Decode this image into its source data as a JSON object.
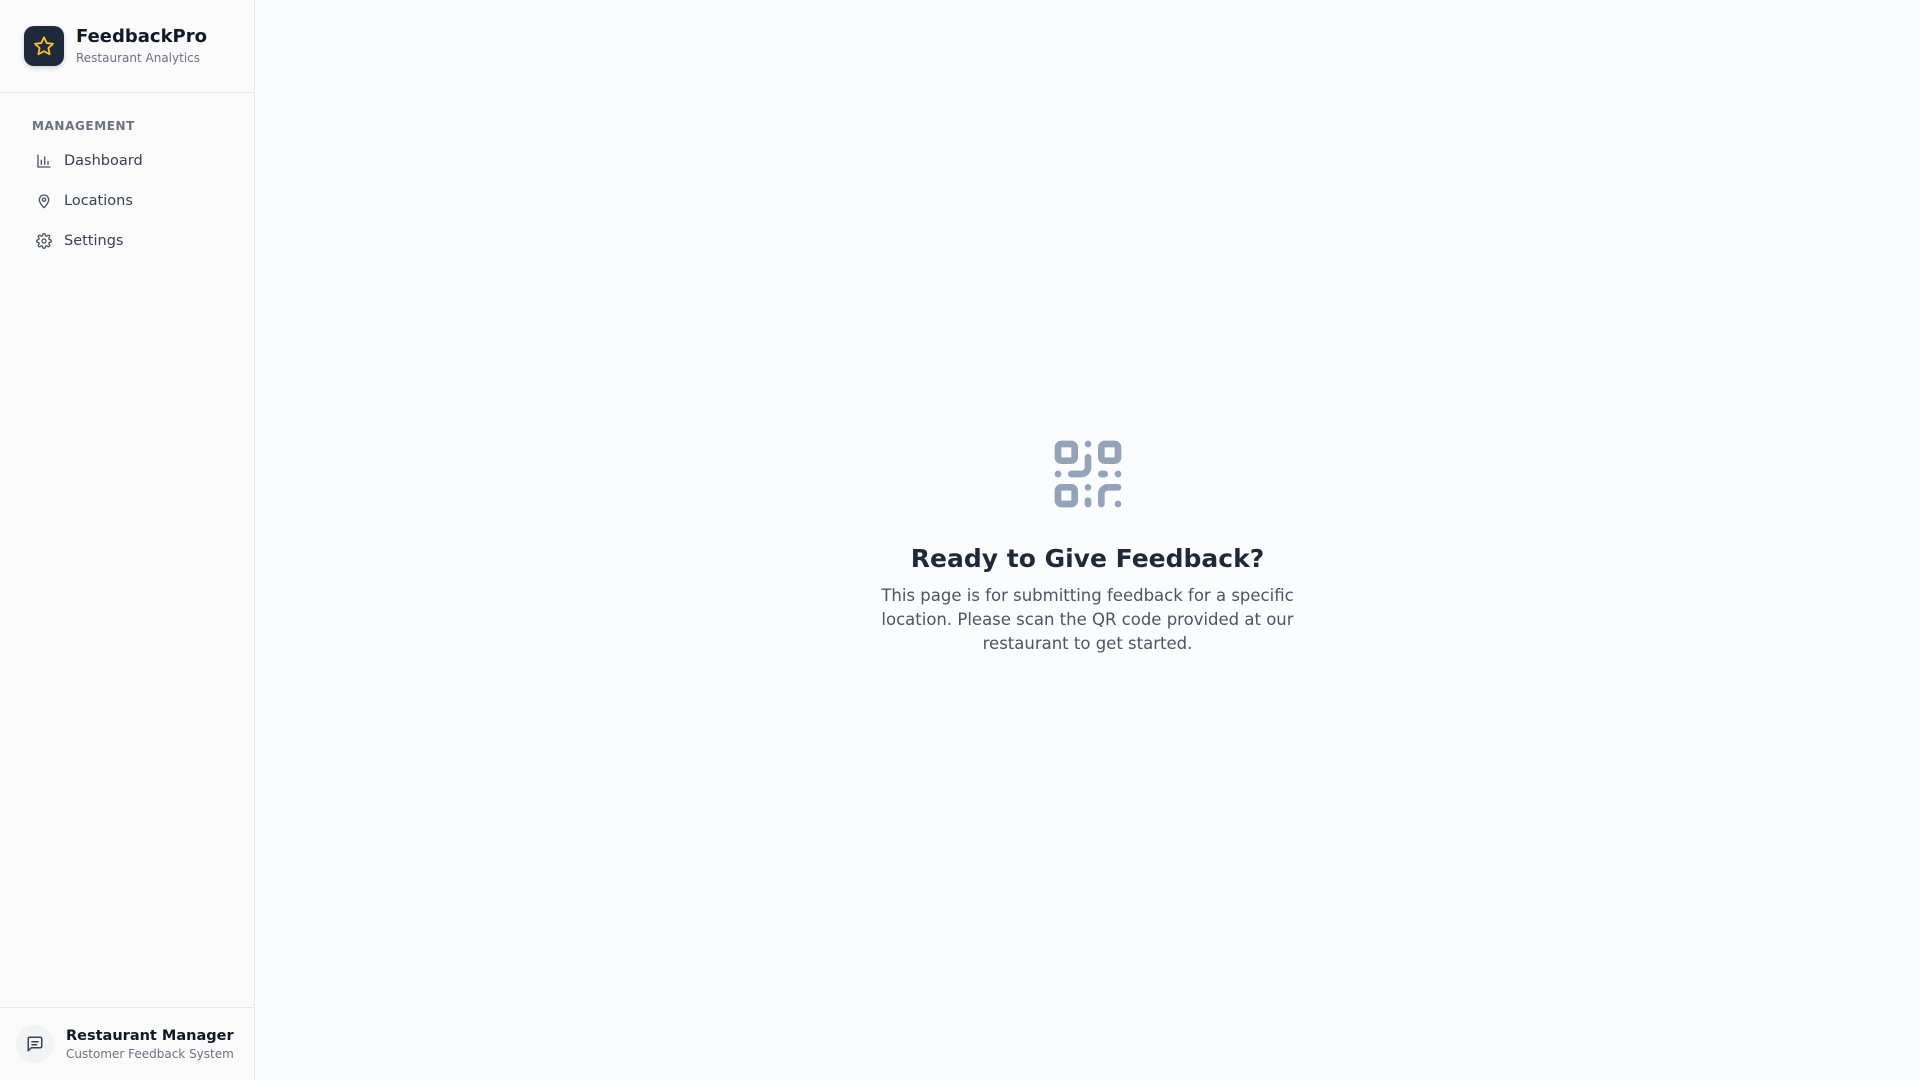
{
  "brand": {
    "name": "FeedbackPro",
    "subtitle": "Restaurant Analytics",
    "logo_icon": "star-icon",
    "accent_color": "#fbbf24"
  },
  "nav": {
    "section_title": "MANAGEMENT",
    "items": [
      {
        "label": "Dashboard",
        "icon": "bar-chart-icon"
      },
      {
        "label": "Locations",
        "icon": "map-pin-icon"
      },
      {
        "label": "Settings",
        "icon": "gear-icon"
      }
    ]
  },
  "footer": {
    "title": "Restaurant Manager",
    "subtitle": "Customer Feedback System",
    "icon": "message-square-icon"
  },
  "main": {
    "icon": "qr-code-icon",
    "title": "Ready to Give Feedback?",
    "description": "This page is for submitting feedback for a specific location. Please scan the QR code provided at our restaurant to get started."
  }
}
